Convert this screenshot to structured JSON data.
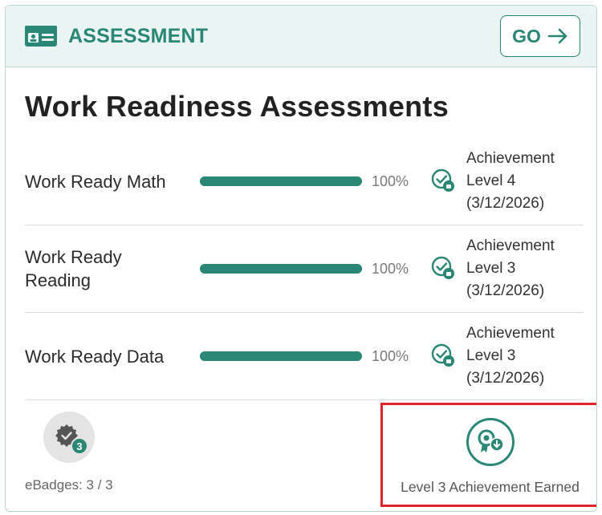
{
  "header": {
    "title": "ASSESSMENT",
    "icon": "id-card-icon",
    "go_label": "GO",
    "accent": "#2a8775"
  },
  "main": {
    "title": "Work Readiness Assessments",
    "assessments": [
      {
        "name": "Work Ready Math",
        "progress": 1.0,
        "percent": "100%",
        "achievement_line1": "Achievement",
        "achievement_line2": "Level 4",
        "achievement_date": "(3/12/2026)"
      },
      {
        "name": "Work Ready Reading",
        "progress": 1.0,
        "percent": "100%",
        "achievement_line1": "Achievement",
        "achievement_line2": "Level 3",
        "achievement_date": "(3/12/2026)"
      },
      {
        "name": "Work Ready Data",
        "progress": 1.0,
        "percent": "100%",
        "achievement_line1": "Achievement",
        "achievement_line2": "Level 3",
        "achievement_date": "(3/12/2026)"
      }
    ]
  },
  "footer": {
    "ebadges_label": "eBadges: 3 / 3",
    "ebadge_count": "3",
    "earned_label": "Level 3 Achievement Earned",
    "highlight_color": "#e0242b"
  }
}
